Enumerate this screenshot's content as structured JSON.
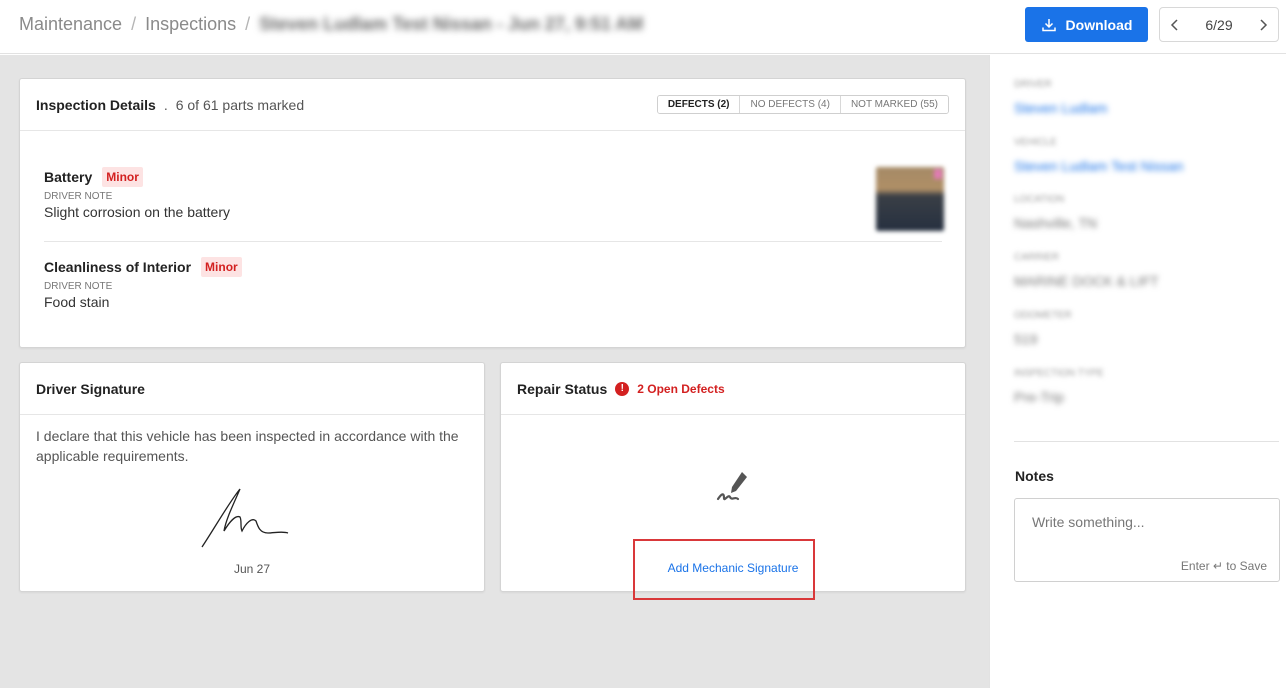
{
  "header": {
    "breadcrumb": [
      "Maintenance",
      "Inspections",
      "Steven Ludlam Test Nissan - Jun 27, 9:51 AM"
    ],
    "separator": "/",
    "download_label": "Download",
    "pager": {
      "current": "6",
      "total": "29",
      "separator": "/"
    }
  },
  "inspection": {
    "title": "Inspection Details",
    "summary_dot": ".",
    "summary": "6 of 61 parts marked",
    "filters": [
      "DEFECTS (2)",
      "NO DEFECTS (4)",
      "NOT MARKED (55)"
    ],
    "defects": [
      {
        "name": "Battery",
        "severity": "Minor",
        "note_label": "DRIVER NOTE",
        "note": "Slight corrosion on the battery"
      },
      {
        "name": "Cleanliness of Interior",
        "severity": "Minor",
        "note_label": "DRIVER NOTE",
        "note": "Food stain"
      }
    ]
  },
  "driver_signature": {
    "title": "Driver Signature",
    "declaration": "I declare that this vehicle has been inspected in accordance with the applicable requirements.",
    "date": "Jun 27"
  },
  "repair_status": {
    "title": "Repair Status",
    "alert_glyph": "!",
    "open_defects": "2 Open Defects",
    "add_signature_label": "Add Mechanic Signature"
  },
  "details": [
    {
      "label": "Driver",
      "value": "Steven Ludlam",
      "link": true
    },
    {
      "label": "Vehicle",
      "value": "Steven Ludlam Test Nissan",
      "link": true
    },
    {
      "label": "Location",
      "value": "Nashville, TN",
      "link": false
    },
    {
      "label": "Carrier",
      "value": "MARINE DOCK & LIFT",
      "link": false
    },
    {
      "label": "Odometer",
      "value": "519",
      "link": false
    },
    {
      "label": "Inspection Type",
      "value": "Pre-Trip",
      "link": false
    }
  ],
  "notes": {
    "title": "Notes",
    "placeholder": "Write something...",
    "save_hint": "Enter ↵ to Save"
  },
  "colors": {
    "accent": "#1a73e8",
    "danger": "#d32020",
    "highlight": "#d9383a"
  }
}
